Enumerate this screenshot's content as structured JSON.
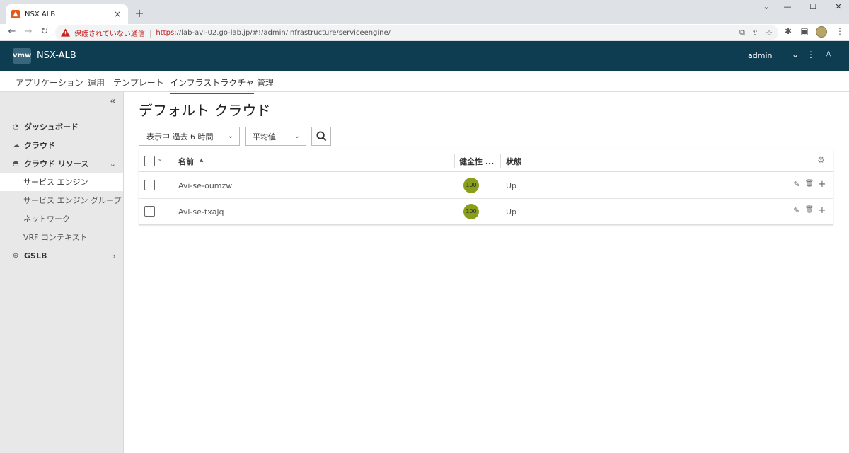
{
  "browser": {
    "tab_title": "NSX ALB",
    "tab_close": "×",
    "new_tab": "+",
    "window_controls": {
      "dropdown": "⌄",
      "minimize": "—",
      "maximize": "☐",
      "close": "✕"
    },
    "nav": {
      "back": "←",
      "forward": "→",
      "reload": "↻"
    },
    "security_text": "保護されていない通信",
    "separator": "|",
    "url_scheme": "https",
    "url_rest": "://lab-avi-02.go-lab.jp/#!/admin/infrastructure/serviceengine/",
    "toolbar_icons": {
      "translate": "⧉",
      "share": "⇪",
      "bookmark": "☆",
      "extensions": "✱",
      "sidepanel": "▣",
      "menu": "⋮"
    }
  },
  "app": {
    "logo": "vmw",
    "title": "NSX-ALB",
    "user": "admin",
    "user_chevron": "⌄",
    "menu_icon": "⋮",
    "profile_icon": "♙"
  },
  "topnav": [
    {
      "label": "アプリケーション"
    },
    {
      "label": "運用"
    },
    {
      "label": "テンプレート"
    },
    {
      "label": "インフラストラクチャ"
    },
    {
      "label": "管理"
    }
  ],
  "sidebar": {
    "collapse": "«",
    "items": [
      {
        "icon": "◔",
        "label": "ダッシュボード"
      },
      {
        "icon": "☁",
        "label": "クラウド"
      },
      {
        "icon": "◓",
        "label": "クラウド リソース",
        "chevron": "⌄"
      },
      {
        "icon": "⊕",
        "label": "GSLB",
        "chevron": "›"
      }
    ],
    "subitems": [
      {
        "label": "サービス エンジン"
      },
      {
        "label": "サービス エンジン グループ"
      },
      {
        "label": "ネットワーク"
      },
      {
        "label": "VRF コンテキスト"
      }
    ]
  },
  "main": {
    "title": "デフォルト クラウド",
    "time_filter": "表示中 過去 6 時間",
    "metric_filter": "平均値",
    "dropdown_arrow": "⌄"
  },
  "grid": {
    "select_chevron": "⌄",
    "columns": {
      "name": "名前",
      "sort": "▲",
      "health": "健全性 ...",
      "status": "状態",
      "settings": "⚙"
    },
    "rows": [
      {
        "name": "Avi-se-oumzw",
        "health": "100",
        "status": "Up"
      },
      {
        "name": "Avi-se-txajq",
        "health": "100",
        "status": "Up"
      }
    ],
    "row_actions": {
      "edit": "✎",
      "delete": "🗑",
      "add": "+"
    }
  },
  "colors": {
    "app_header": "#0e3d52",
    "health_good": "#8a9e1a",
    "active_tab_underline": "#0072a3",
    "insecure": "#c5221f"
  }
}
